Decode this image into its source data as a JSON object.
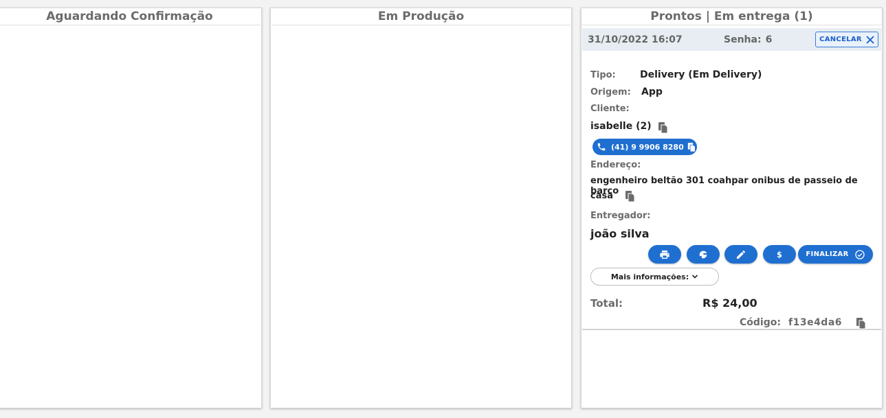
{
  "columns": [
    {
      "title": "Aguardando Confirmação"
    },
    {
      "title": "Em Produção"
    },
    {
      "title": "Prontos | Em entrega (1)"
    }
  ],
  "order": {
    "datetime": "31/10/2022 16:07",
    "senha_label": "Senha:",
    "senha_value": "6",
    "cancel_label": "CANCELAR",
    "tipo_label": "Tipo:",
    "tipo_value": "Delivery (Em Delivery)",
    "origem_label": "Origem:",
    "origem_value": "App",
    "cliente_label": "Cliente:",
    "cliente_value": "isabelle (2)",
    "phone": "(41) 9 9906 8280",
    "endereco_label": "Endereço:",
    "endereco_line1": "engenheiro beltão 301 coahpar onibus de passeio de barco",
    "endereco_line2": "casa",
    "entregador_label": "Entregador:",
    "entregador_value": "joão silva",
    "finalizar_label": "FINALIZAR",
    "mais_label": "Mais informações:",
    "total_label": "Total:",
    "total_value": "R$ 24,00",
    "codigo_label": "Código:",
    "codigo_value": "f13e4da6"
  },
  "colors": {
    "accent": "#1f6fd1",
    "header_bg": "#e7edf3",
    "label_gray": "#6b6b6b"
  },
  "icons": [
    "close-icon",
    "copy-icon",
    "phone-icon",
    "print-icon",
    "moped-icon",
    "edit-icon",
    "dollar-icon",
    "check-circle-icon",
    "chevron-down-icon"
  ]
}
